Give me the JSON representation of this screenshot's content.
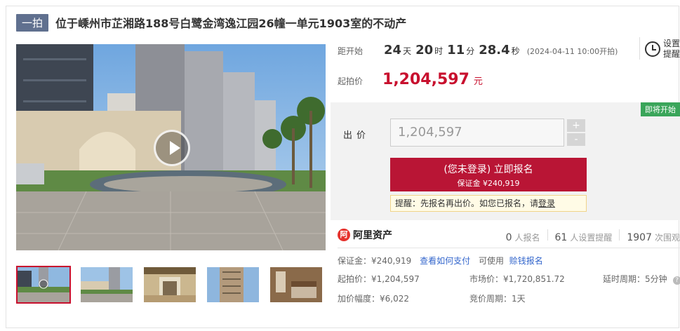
{
  "listing": {
    "tag": "一拍",
    "title": "位于嵊州市芷湘路188号白鹭金湾逸江园26幢一单元1903室的不动产"
  },
  "countdown": {
    "label": "距开始",
    "days": "24",
    "days_unit": "天",
    "hours": "20",
    "hours_unit": "时",
    "minutes": "11",
    "minutes_unit": "分",
    "seconds": "28.4",
    "seconds_unit": "秒",
    "start_time": "(2024-04-11 10:00开拍)"
  },
  "remind": {
    "line1": "设置",
    "line2": "提醒"
  },
  "start_price": {
    "label": "起拍价",
    "value": "1,204,597",
    "unit": "元"
  },
  "bid": {
    "status_badge": "即将开始",
    "label": "出价",
    "input_value": "1,204,597",
    "plus": "+",
    "minus": "-",
    "signup_line1": "(您未登录) 立即报名",
    "signup_line2": "保证金 ¥240,919",
    "tip_prefix": "提醒：先报名再出价。如您已报名，请",
    "tip_link": "登录"
  },
  "brand": {
    "logo_mark": "阿",
    "name": "阿里资产"
  },
  "stats": {
    "signups": "0",
    "signups_label": "人报名",
    "reminders": "61",
    "reminders_label": "人设置提醒",
    "views": "1907",
    "views_label": "次围观"
  },
  "deposit": {
    "text": "保证金：¥240,919",
    "how_to_pay": "查看如何支付",
    "available": "可使用",
    "credit": "赊钱报名"
  },
  "details": {
    "start_price": "起拍价：¥1,204,597",
    "market_price": "市场价：¥1,720,851.72",
    "delay_period": "延时周期：5分钟",
    "increment": "加价幅度：¥6,022",
    "bidding_period": "竞价周期：1天"
  },
  "colors": {
    "accent": "#c8102e",
    "button": "#b91535",
    "badge_green": "#3aa55a",
    "tag_bg": "#60708f",
    "link": "#3366cc"
  }
}
